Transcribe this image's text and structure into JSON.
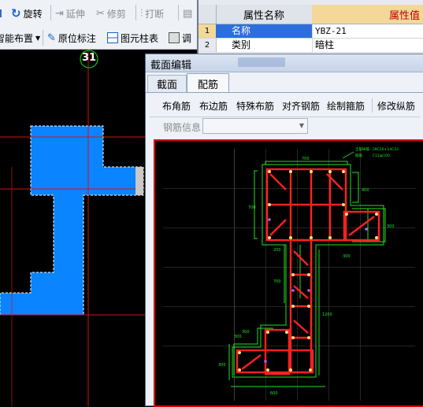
{
  "toolbar_top": {
    "rotate_label": "旋转",
    "extend_label": "延伸",
    "trim_label": "修剪",
    "break_label": "打断"
  },
  "toolbar_second": {
    "smart_layout_label": "智能布置",
    "in_situ_label": "原位标注",
    "column_table_label": "图元柱表",
    "adjust_label": "调"
  },
  "axis_marker": {
    "label": "31"
  },
  "property_grid": {
    "header_name": "属性名称",
    "header_value": "属性值",
    "rows": [
      {
        "num": "1",
        "name": "名称",
        "value": "YBZ-21"
      },
      {
        "num": "2",
        "name": "类别",
        "value": "暗柱"
      }
    ]
  },
  "dialog": {
    "title": "截面编辑",
    "tabs": [
      {
        "label": "截面",
        "active": false
      },
      {
        "label": "配筋",
        "active": true
      }
    ],
    "buttons": [
      {
        "label": "布角筋"
      },
      {
        "label": "布边筋"
      },
      {
        "label": "特殊布筋"
      },
      {
        "label": "对齐钢筋"
      },
      {
        "label": "绘制箍筋"
      },
      {
        "label": "修改纵筋"
      }
    ],
    "rebar_info_label": "钢筋信息",
    "rebar_info_value": ""
  },
  "colors": {
    "plan_fill": "#0a84ff",
    "axis_line": "#d11414",
    "marker": "#00c800",
    "section_rebar": "#ff2020",
    "section_dim": "#22e022",
    "canvas_border": "#e00000"
  }
}
